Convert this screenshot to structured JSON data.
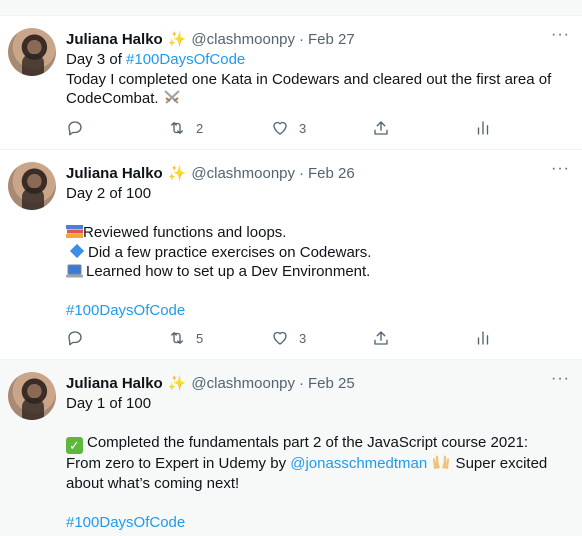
{
  "icons": {
    "more": "more-icon",
    "reply": "reply-icon",
    "retweet": "retweet-icon",
    "like": "like-icon",
    "share": "share-icon",
    "analytics": "analytics-icon",
    "sparkle": "sparkles-icon"
  },
  "colors": {
    "link": "#1d9bf0",
    "muted": "#536471",
    "text": "#0f1419"
  },
  "tweets": [
    {
      "name": "Juliana Halko",
      "sparkle": "✨",
      "handle": "@clashmoonpy",
      "dot": "·",
      "date": "Feb 27",
      "more": "···",
      "line1_prefix": "Day 3 of ",
      "hashtag": "#100DaysOfCode",
      "line2": "Today I completed one Kata in  Codewars and cleared out the first area of",
      "line3": "CodeCombat.",
      "retweets": "2",
      "likes": "3"
    },
    {
      "name": "Juliana Halko",
      "sparkle": "✨",
      "handle": "@clashmoonpy",
      "dot": "·",
      "date": "Feb 26",
      "more": "···",
      "line1": "Day 2 of 100",
      "item1": "Reviewed functions and loops.",
      "item2": "Did a few practice exercises on Codewars.",
      "item3": "Learned how to set up a Dev Environment.",
      "hashtag": "#100DaysOfCode",
      "retweets": "5",
      "likes": "3"
    },
    {
      "name": "Juliana Halko",
      "sparkle": "✨",
      "handle": "@clashmoonpy",
      "dot": "·",
      "date": "Feb 25",
      "more": "···",
      "line1": "Day 1 of 100",
      "check": "✓",
      "line2": "Completed the fundamentals part 2 of the JavaScript course 2021:",
      "line3_prefix": "From zero to Expert in Udemy by ",
      "mention": "@jonasschmedtman",
      "line3_suffix": " Super excited",
      "line4": "about what’s coming next!",
      "hashtag": "#100DaysOfCode"
    }
  ]
}
